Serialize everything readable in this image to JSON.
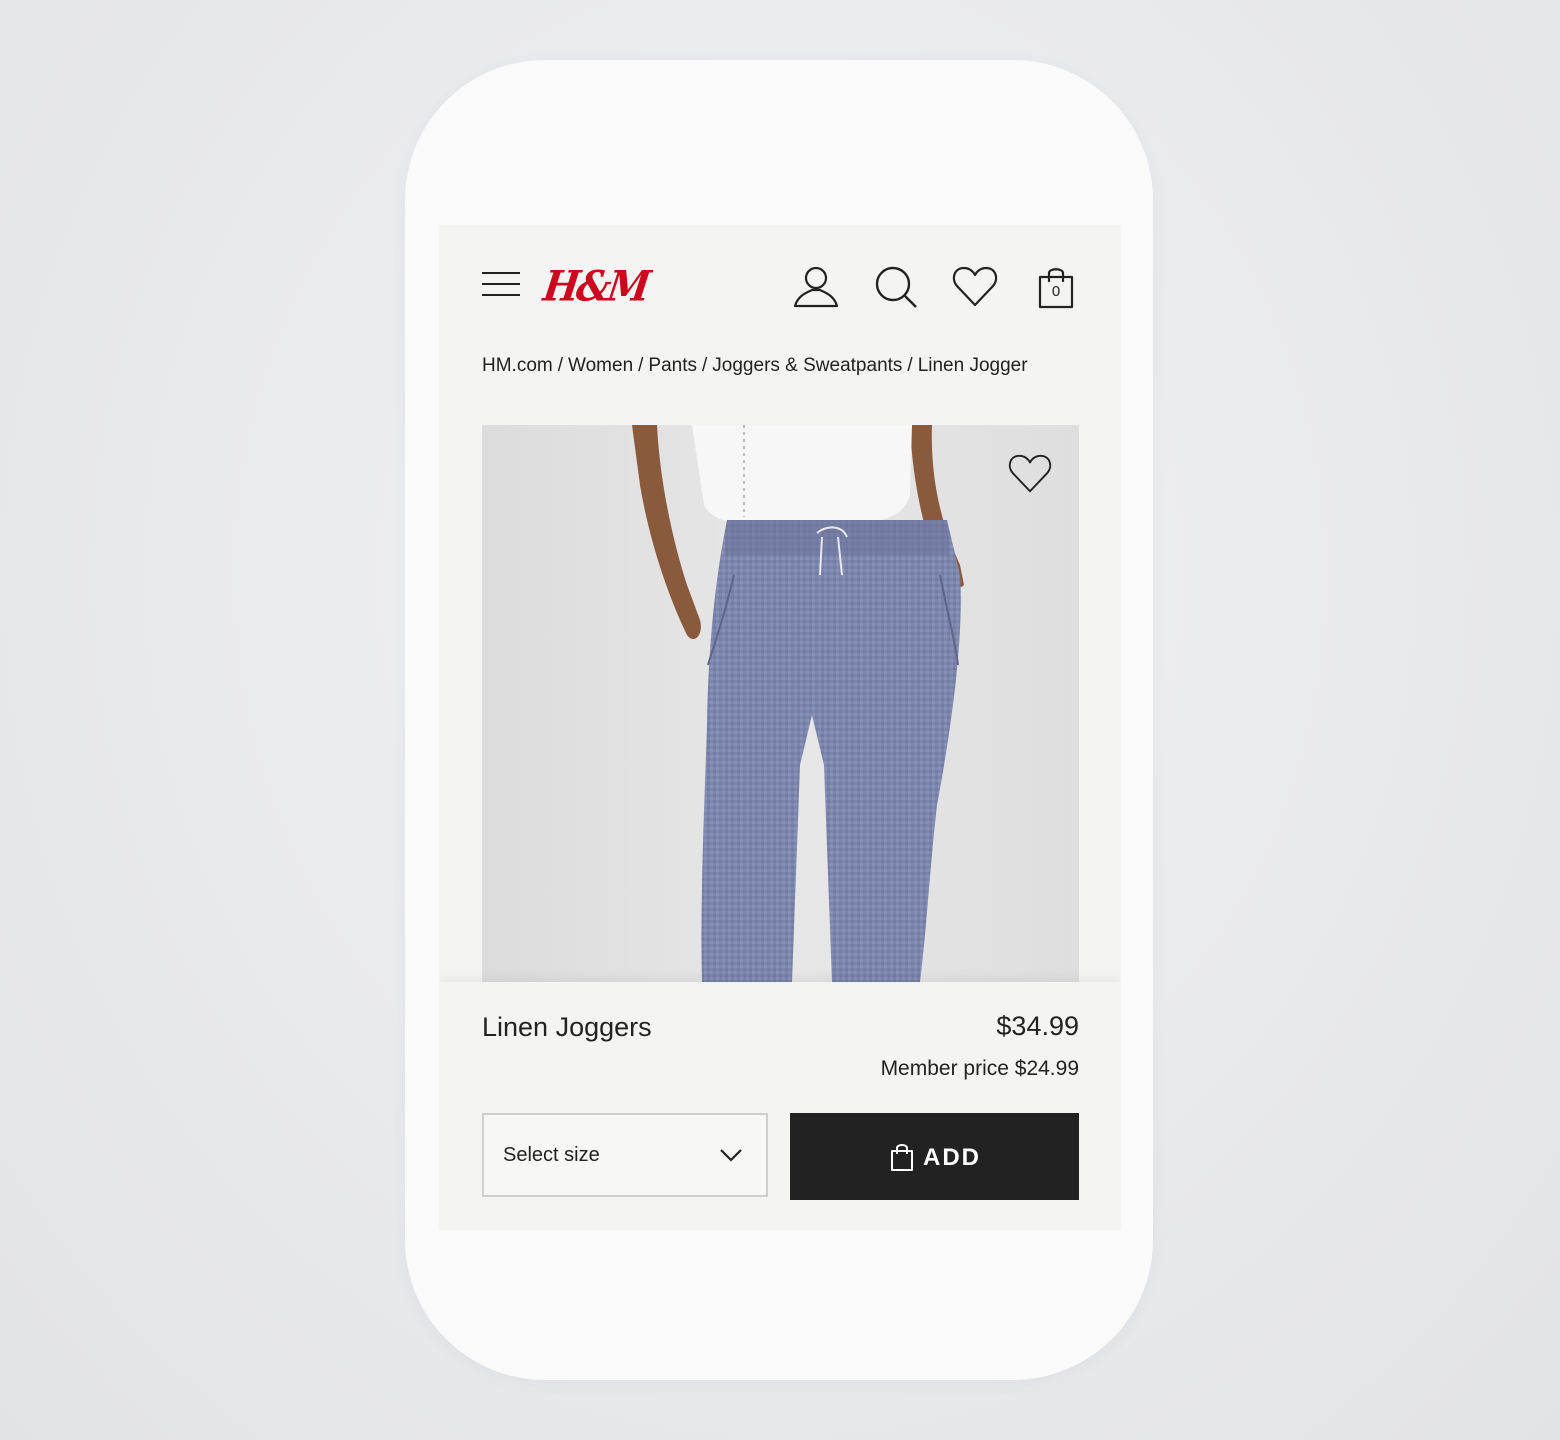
{
  "header": {
    "logo_text": "H&M",
    "cart_count": "0",
    "icons": [
      "menu-icon",
      "account-icon",
      "search-icon",
      "heart-icon",
      "shopping-bag-icon"
    ]
  },
  "breadcrumb": [
    "HM.com",
    "Women",
    "Pants",
    "Joggers & Sweatpants",
    "Linen Jogger"
  ],
  "product": {
    "name": "Linen Joggers",
    "price": "$34.99",
    "member_price": "Member price $24.99",
    "size_placeholder": "Select size",
    "add_label": "ADD"
  },
  "colors": {
    "brand_red": "#cc071e",
    "button_black": "#222222",
    "screen_bg": "#f4f4f3"
  }
}
